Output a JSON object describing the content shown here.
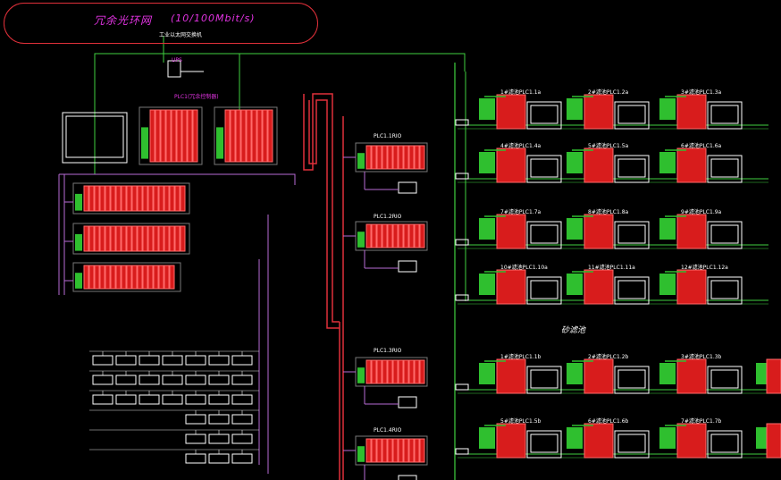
{
  "diagram": {
    "title": "冗余光环网",
    "network_speed": "(10/100Mbit/s)",
    "switch_label": "工业以太网交换机",
    "ups_label": "UPS",
    "plc1_label": "PLC1(冗余控制器)",
    "rio_labels": [
      "PLC1.1RIO",
      "PLC1.2RIO",
      "PLC1.3RIO",
      "PLC1.4RIO"
    ],
    "section_label": "砂滤池",
    "pump_station_labels": [
      "1#滤池PLC1.1a",
      "2#滤池PLC1.2a",
      "3#滤池PLC1.3a",
      "4#滤池PLC1.4a",
      "5#滤池PLC1.5a",
      "6#滤池PLC1.6a",
      "7#滤池PLC1.7a",
      "8#滤池PLC1.8a",
      "9#滤池PLC1.9a",
      "10#滤池PLC1.10a",
      "11#滤池PLC1.11a",
      "12#滤池PLC1.12a",
      "1#滤池PLC1.1b",
      "2#滤池PLC1.2b",
      "3#滤池PLC1.3b",
      "5#滤池PLC1.5b",
      "6#滤池PLC1.6b",
      "7#滤池PLC1.7b"
    ],
    "colors": {
      "ring": "#e0303a",
      "ethernet": "#3fd13f",
      "fieldbus": "#b86bd6",
      "label": "#e233e2",
      "module": "#d81c1c",
      "monitor": "#ffffff"
    }
  }
}
